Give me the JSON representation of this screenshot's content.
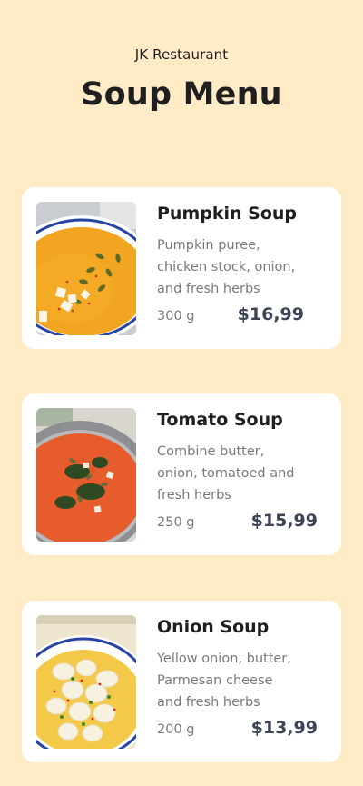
{
  "header": {
    "restaurant_name": "JK Restaurant",
    "title": "Soup Menu"
  },
  "items": [
    {
      "name": "Pumpkin Soup",
      "description": "Pumpkin puree,\nchicken stock, onion,\nand fresh herbs",
      "weight": "300 g",
      "price": "$16,99",
      "image_icon": "pumpkin-soup-image"
    },
    {
      "name": "Tomato Soup",
      "description": "Combine butter,\nonion, tomatoed and\nfresh herbs",
      "weight": "250 g",
      "price": "$15,99",
      "image_icon": "tomato-soup-image"
    },
    {
      "name": "Onion Soup",
      "description": "Yellow onion, butter,\nParmesan cheese\nand fresh herbs",
      "weight": "200 g",
      "price": "$13,99",
      "image_icon": "onion-soup-image"
    }
  ],
  "colors": {
    "background": "#ffecc6",
    "card": "#ffffff",
    "price": "#3c4456",
    "muted_text": "#7a7a7a"
  }
}
